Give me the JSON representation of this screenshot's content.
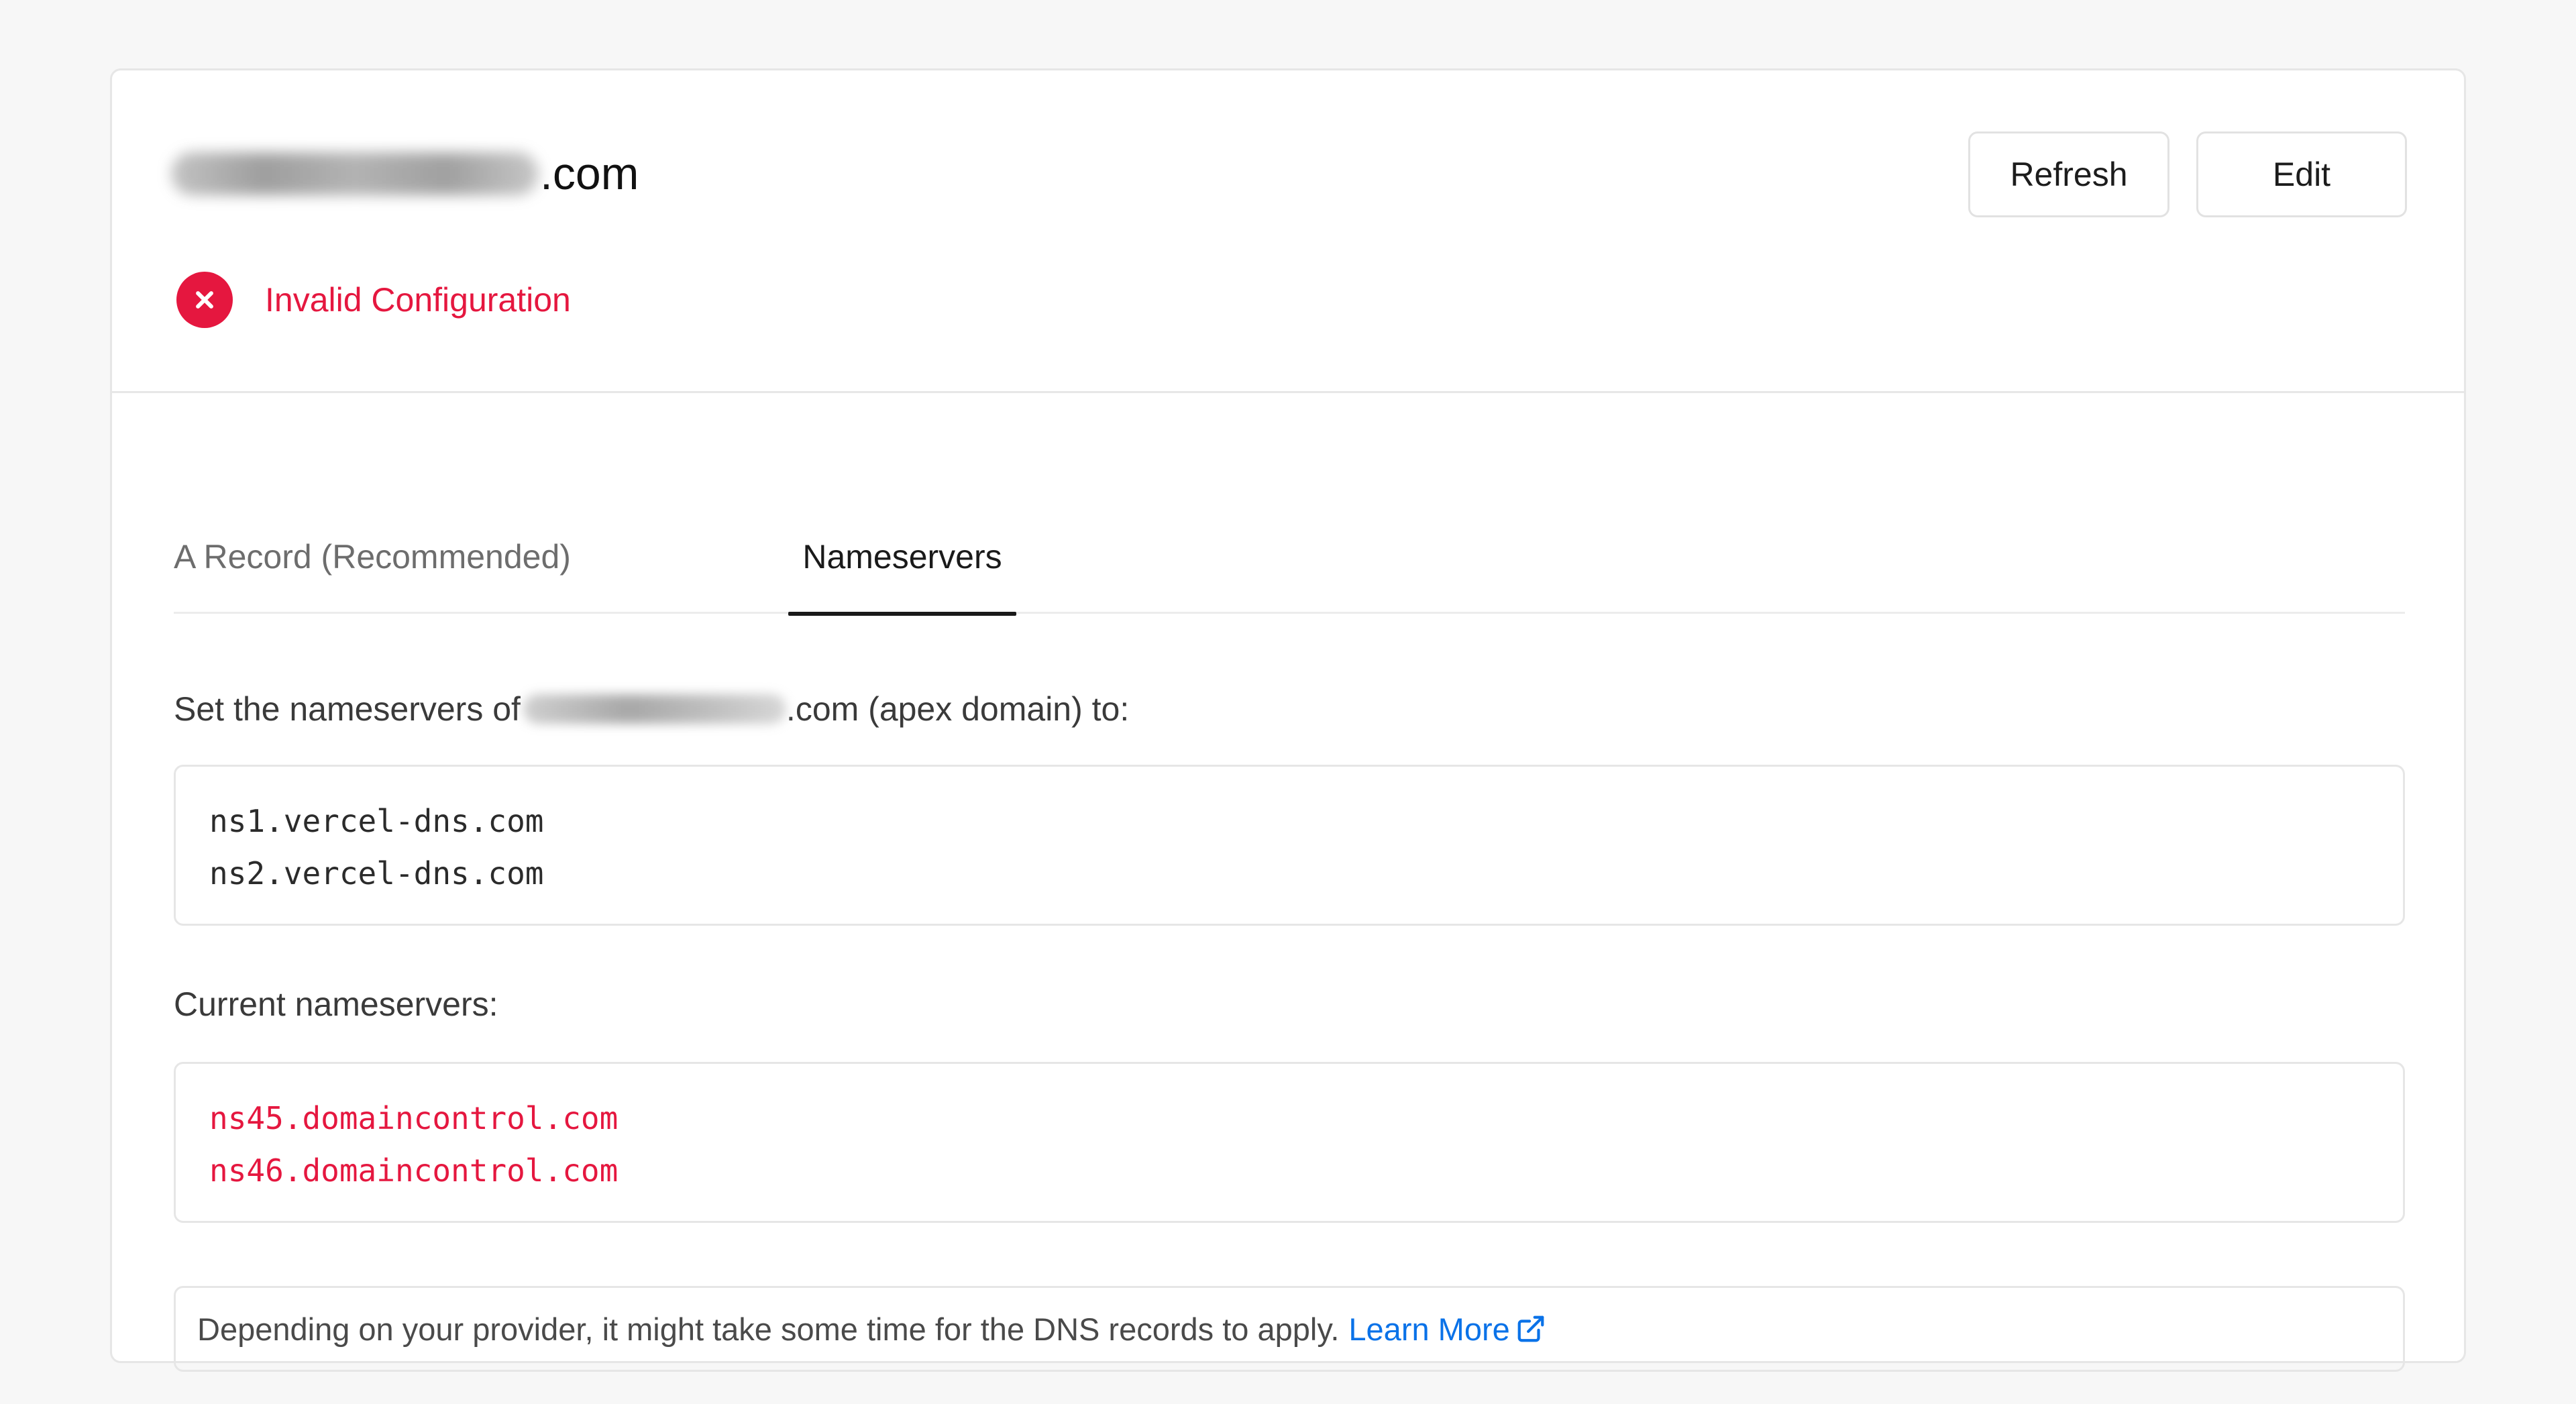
{
  "header": {
    "domain_suffix": ".com",
    "refresh_label": "Refresh",
    "edit_label": "Edit"
  },
  "status": {
    "icon": "x-circle-icon",
    "text": "Invalid Configuration",
    "color": "#e5173f"
  },
  "tabs": [
    {
      "label": "A Record (Recommended)",
      "active": false
    },
    {
      "label": "Nameservers",
      "active": true
    }
  ],
  "nameservers": {
    "instruction_prefix": "Set the nameservers of ",
    "instruction_suffix": ".com (apex domain) to:",
    "expected": [
      "ns1.vercel-dns.com",
      "ns2.vercel-dns.com"
    ],
    "current_label": "Current nameservers:",
    "current": [
      "ns45.domaincontrol.com",
      "ns46.domaincontrol.com"
    ]
  },
  "note": {
    "text": "Depending on your provider, it might take some time for the DNS records to apply.",
    "link_label": "Learn More",
    "link_icon": "external-link-icon",
    "link_color": "#0a72e8"
  }
}
